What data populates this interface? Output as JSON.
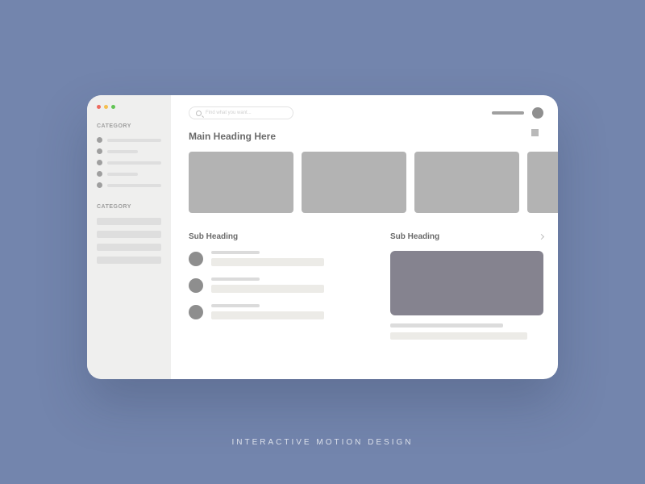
{
  "footer": "INTERACTIVE MOTION DESIGN",
  "sidebar": {
    "cat1_label": "CATEGORY",
    "cat2_label": "CATEGORY"
  },
  "topbar": {
    "search_placeholder": "Find what you want..."
  },
  "main": {
    "heading": "Main Heading Here",
    "sub_left": "Sub Heading",
    "sub_right": "Sub Heading"
  }
}
